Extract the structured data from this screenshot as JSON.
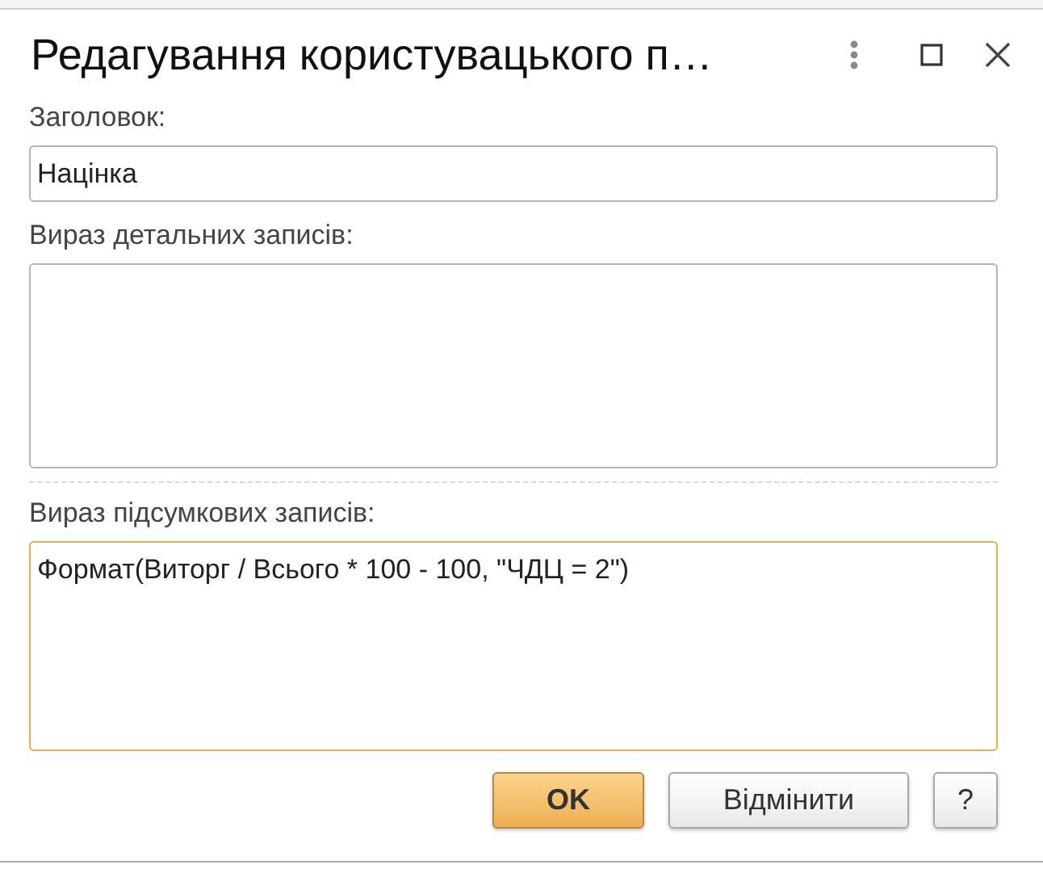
{
  "window": {
    "title": "Редагування користувацького п…"
  },
  "fields": [
    {
      "label": "Заголовок:",
      "kind": "input",
      "value": "Націнка",
      "focused": false
    },
    {
      "label": "Вираз детальних записів:",
      "kind": "textarea",
      "focused": false
    },
    {
      "label": "Вираз підсумкових записів:",
      "kind": "textarea",
      "value": "Формат(Виторг / Всього * 100 - 100, \"ЧДЦ = 2\")",
      "focused": true
    }
  ],
  "buttons": [
    {
      "label": "OK",
      "kind": "primary"
    },
    {
      "label": "Відмінити",
      "kind": "default"
    },
    {
      "label": "?",
      "kind": "help"
    }
  ]
}
